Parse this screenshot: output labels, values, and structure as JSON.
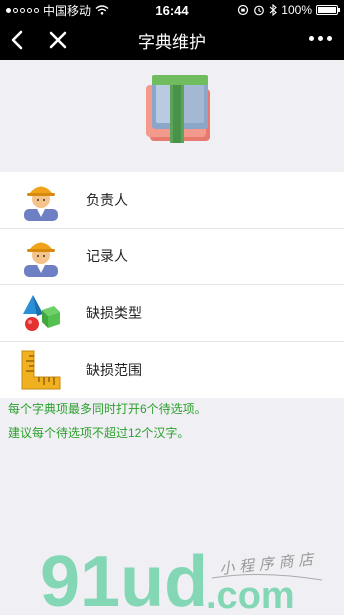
{
  "status_bar": {
    "carrier": "中国移动",
    "time": "16:44",
    "battery": "100%"
  },
  "nav": {
    "title": "字典维护"
  },
  "list": {
    "items": [
      {
        "label": "负责人",
        "icon": "worker-icon"
      },
      {
        "label": "记录人",
        "icon": "worker-icon"
      },
      {
        "label": "缺损类型",
        "icon": "shapes-icon"
      },
      {
        "label": "缺损范围",
        "icon": "ruler-icon"
      }
    ]
  },
  "tips": [
    "每个字典项最多同时打开6个待选项。",
    "建议每个待选项不超过12个汉字。"
  ],
  "watermark": {
    "logo_text": "91ud.com",
    "slogan": "小程序商店"
  },
  "colors": {
    "tip_text": "#2ca02c",
    "nav_bg": "#000000",
    "page_bg": "#efeff4"
  }
}
